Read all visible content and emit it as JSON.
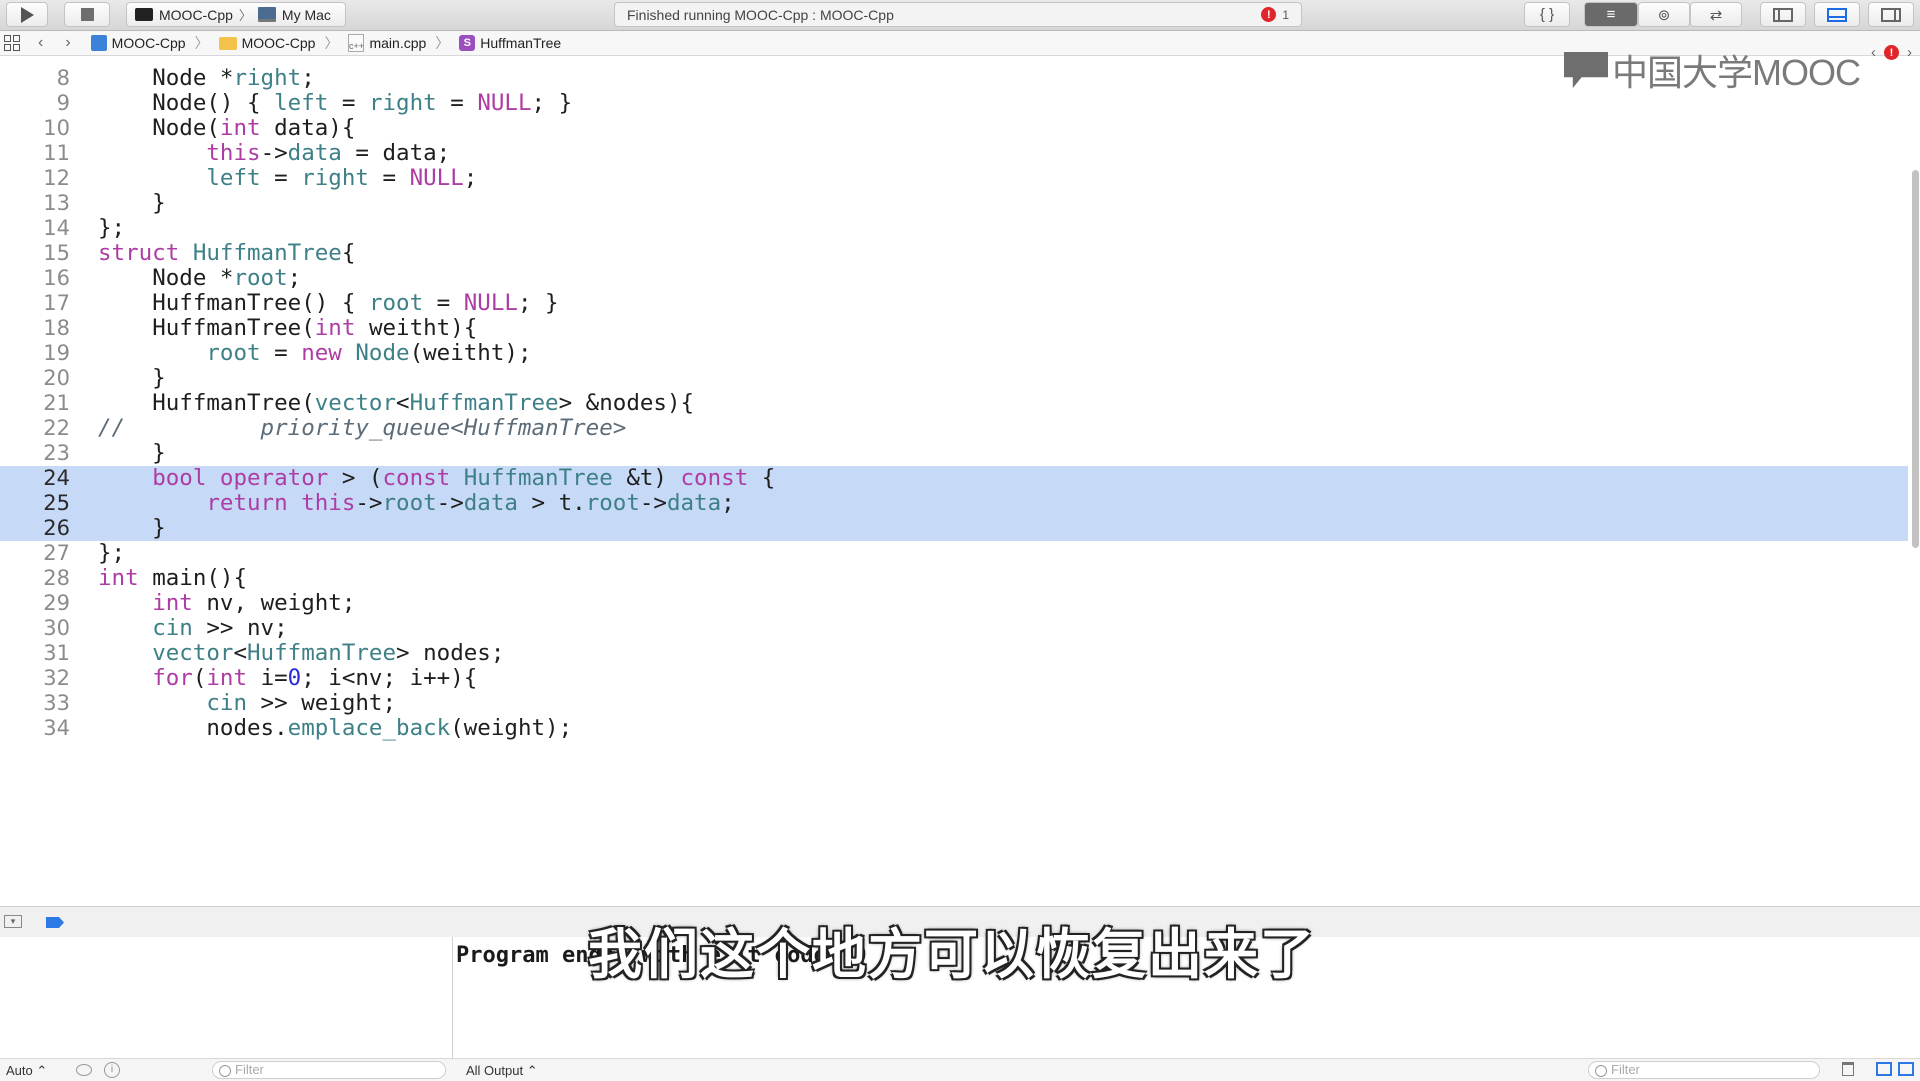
{
  "toolbar": {
    "scheme_target": "MOOC-Cpp",
    "scheme_device": "My Mac",
    "activity_status": "Finished running MOOC-Cpp : MOOC-Cpp",
    "error_count": "1",
    "editor_standard_icon": "lines-icon",
    "braces_label": "{ }"
  },
  "jumpbar": {
    "crumbs": [
      "MOOC-Cpp",
      "MOOC-Cpp",
      "main.cpp",
      "HuffmanTree"
    ],
    "symbol_badge": "S",
    "watermark": "中国大学MOOC"
  },
  "editor": {
    "highlight_color": "#c6d9f6",
    "lines": [
      {
        "n": "8",
        "t": "    Node *right;"
      },
      {
        "n": "9",
        "t": "    Node() { left = right = NULL; }"
      },
      {
        "n": "10",
        "t": "    Node(int data){"
      },
      {
        "n": "11",
        "t": "        this->data = data;"
      },
      {
        "n": "12",
        "t": "        left = right = NULL;"
      },
      {
        "n": "13",
        "t": "    }"
      },
      {
        "n": "14",
        "t": "};"
      },
      {
        "n": "15",
        "t": "struct HuffmanTree{"
      },
      {
        "n": "16",
        "t": "    Node *root;"
      },
      {
        "n": "17",
        "t": "    HuffmanTree() { root = NULL; }"
      },
      {
        "n": "18",
        "t": "    HuffmanTree(int weitht){"
      },
      {
        "n": "19",
        "t": "        root = new Node(weitht);"
      },
      {
        "n": "20",
        "t": "    }"
      },
      {
        "n": "21",
        "t": "    HuffmanTree(vector<HuffmanTree> &nodes){"
      },
      {
        "n": "22",
        "t": "//          priority_queue<HuffmanTree>"
      },
      {
        "n": "23",
        "t": "    }"
      },
      {
        "n": "24",
        "t": "    bool operator > (const HuffmanTree &t) const {"
      },
      {
        "n": "25",
        "t": "        return this->root->data > t.root->data;"
      },
      {
        "n": "26",
        "t": "    }"
      },
      {
        "n": "27",
        "t": "};"
      },
      {
        "n": "28",
        "t": "int main(){"
      },
      {
        "n": "29",
        "t": "    int nv, weight;"
      },
      {
        "n": "30",
        "t": "    cin >> nv;"
      },
      {
        "n": "31",
        "t": "    vector<HuffmanTree> nodes;"
      },
      {
        "n": "32",
        "t": "    for(int i=0; i<nv; i++){"
      },
      {
        "n": "33",
        "t": "        cin >> weight;"
      },
      {
        "n": "34",
        "t": "        nodes.emplace_back(weight);"
      }
    ]
  },
  "console": {
    "output": "Program ended with exit code: 0",
    "subtitle": "我们这个地方可以恢复出来了"
  },
  "bottom": {
    "auto_label": "Auto ⌃",
    "filter_placeholder": "Filter",
    "output_label": "All Output ⌃"
  }
}
